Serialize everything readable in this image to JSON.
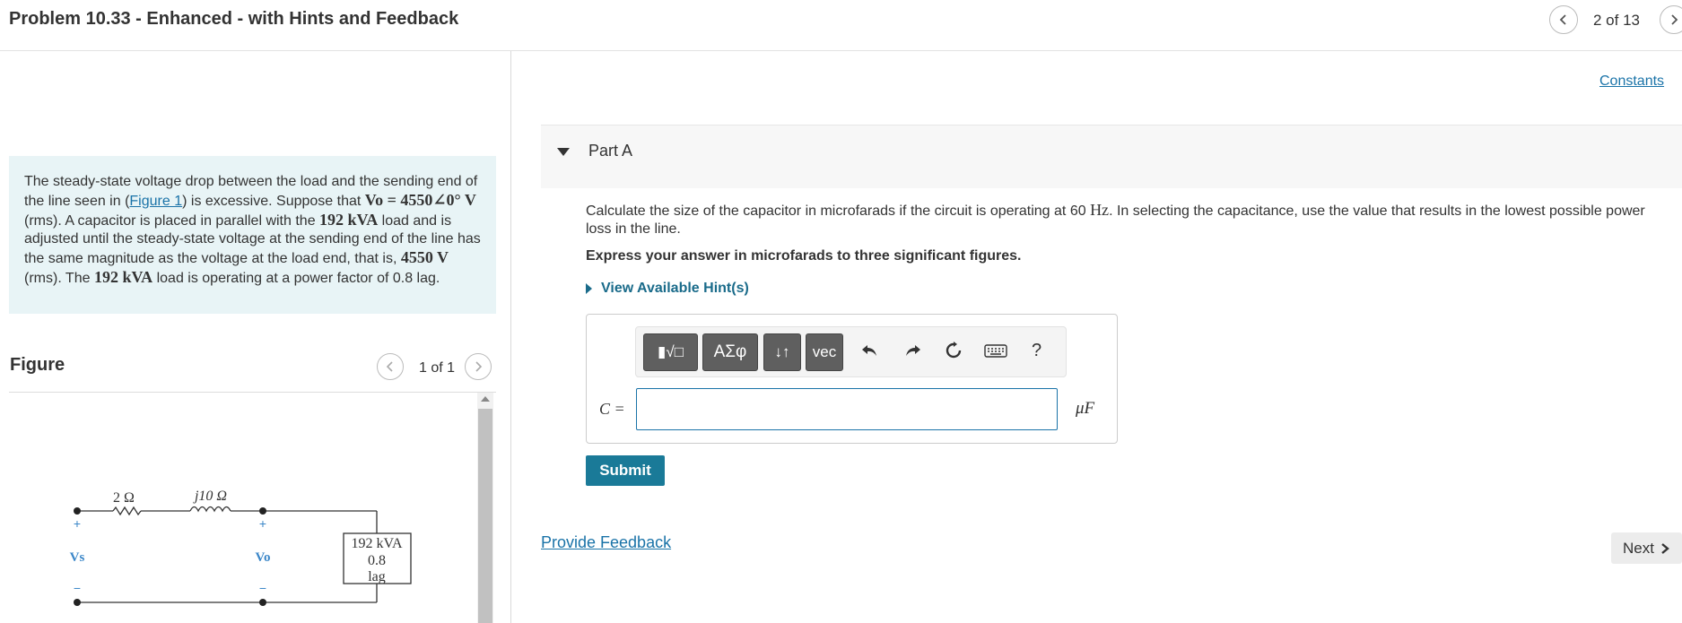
{
  "header": {
    "title": "Problem 10.33 - Enhanced - with Hints and Feedback",
    "nav_count": "2 of 13"
  },
  "problem": {
    "text_1": "The steady-state voltage drop between the load and the sending end of the line seen in (",
    "figure_link": "Figure 1",
    "text_2": ") is excessive. Suppose that ",
    "voltage_expr": "Vo = 4550∠0° V",
    "text_3": " (rms). A capacitor is placed in parallel with the ",
    "load_expr": "192 kVA",
    "text_4": " load and is adjusted until the steady-state voltage at the sending end of the line has the same magnitude as the voltage at the load end, that is, ",
    "voltage_mag": "4550 V",
    "text_5": " (rms). The ",
    "load_expr_2": "192 kVA",
    "text_6": " load is operating at a power factor of 0.8 lag."
  },
  "figure": {
    "title": "Figure",
    "count": "1 of 1",
    "circuit": {
      "r_label": "2 Ω",
      "x_label": "j10 Ω",
      "vs_label": "Vs",
      "vo_label": "Vo",
      "load_line1": "192 kVA",
      "load_line2": "0.8",
      "load_line3": "lag",
      "plus": "+",
      "minus": "−"
    }
  },
  "constants_link": "Constants",
  "part": {
    "label": "Part A",
    "question_1": "Calculate the size of the capacitor in microfarads if the circuit is operating at 60 ",
    "question_unit": "Hz",
    "question_2": ". In selecting the capacitance, use the value that results in the lowest possible power loss in the line.",
    "instruction": "Express your answer in microfarads to three significant figures.",
    "hints_label": "View Available Hint(s)",
    "toolbar": {
      "templates_label": "▮√□",
      "greek_label": "ΑΣφ",
      "arrows_label": "↓↑",
      "vec_label": "vec",
      "help_label": "?"
    },
    "answer_var": "C =",
    "answer_value": "",
    "answer_unit": "μF",
    "submit_label": "Submit"
  },
  "feedback_link": "Provide Feedback",
  "next_label": "Next"
}
